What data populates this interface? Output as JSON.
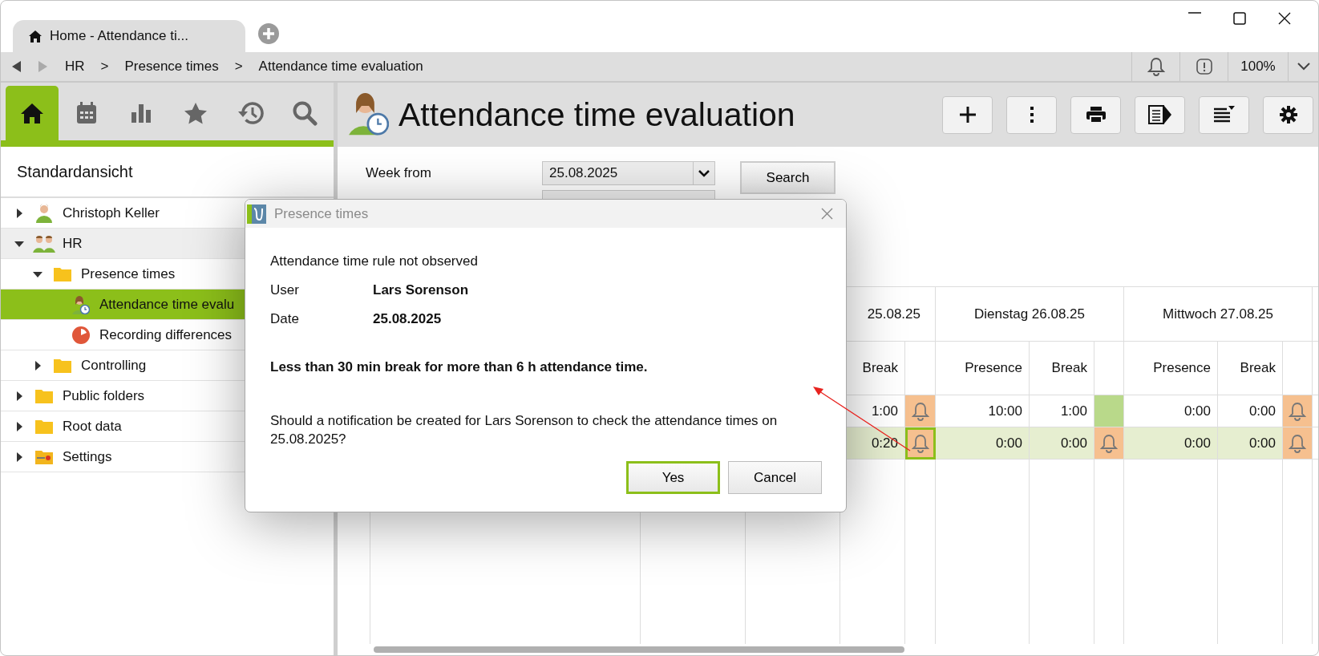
{
  "tab": {
    "label": "Home - Attendance ti..."
  },
  "breadcrumb": {
    "separator": ">",
    "items": [
      "HR",
      "Presence times",
      "Attendance time evaluation"
    ]
  },
  "status": {
    "zoom": "100%"
  },
  "sidebar": {
    "tabs": [
      {
        "kind": "home",
        "selected": true
      },
      {
        "kind": "calendar",
        "selected": false
      },
      {
        "kind": "chart",
        "selected": false
      },
      {
        "kind": "star",
        "selected": false
      },
      {
        "kind": "history",
        "selected": false
      },
      {
        "kind": "search",
        "selected": false
      }
    ],
    "view_title": "Standardansicht",
    "tree": [
      {
        "label": "Christoph Keller",
        "kind": "person",
        "expanded": false,
        "selected": false,
        "hovered": false
      },
      {
        "label": "HR",
        "kind": "group",
        "expanded": true,
        "selected": false,
        "hovered": true,
        "children": [
          {
            "label": "Presence times",
            "kind": "folder",
            "expanded": true,
            "selected": false,
            "hovered": false,
            "children": [
              {
                "label": "Attendance time evalu",
                "kind": "attendance",
                "selected": true,
                "hovered": false
              },
              {
                "label": "Recording differences",
                "kind": "pie",
                "selected": false,
                "hovered": false
              }
            ]
          },
          {
            "label": "Controlling",
            "kind": "folder",
            "expanded": false,
            "selected": false,
            "hovered": false
          }
        ]
      },
      {
        "label": "Public folders",
        "kind": "folder",
        "expanded": false,
        "selected": false,
        "hovered": false
      },
      {
        "label": "Root data",
        "kind": "folder",
        "expanded": false,
        "selected": false,
        "hovered": false
      },
      {
        "label": "Settings",
        "kind": "settings_folder",
        "expanded": false,
        "selected": false,
        "hovered": false
      }
    ]
  },
  "page": {
    "title": "Attendance time evaluation",
    "toolbar": [
      {
        "kind": "add"
      },
      {
        "kind": "more"
      },
      {
        "kind": "print"
      },
      {
        "kind": "panel"
      },
      {
        "kind": "sort"
      },
      {
        "kind": "settings"
      }
    ]
  },
  "form": {
    "week_label": "Week from",
    "week_value": "25.08.2025",
    "search_button": "Search"
  },
  "table": {
    "days": [
      {
        "header": "25.08.25",
        "break_label": "Break"
      },
      {
        "header": "Dienstag 26.08.25",
        "presence_label": "Presence",
        "break_label": "Break"
      },
      {
        "header": "Mittwoch 27.08.25",
        "presence_label": "Presence",
        "break_label": "Break"
      }
    ],
    "rows": [
      {
        "selected": false,
        "days": [
          {
            "break": "1:00",
            "alert": true,
            "selected": false
          },
          {
            "presence": "10:00",
            "break": "1:00",
            "alert": false,
            "selected": false
          },
          {
            "presence": "0:00",
            "break": "0:00",
            "alert": true,
            "selected": false
          }
        ]
      },
      {
        "selected": true,
        "days": [
          {
            "break": "0:20",
            "alert": true,
            "selected": true
          },
          {
            "presence": "0:00",
            "break": "0:00",
            "alert": true,
            "selected": false
          },
          {
            "presence": "0:00",
            "break": "0:00",
            "alert": true,
            "selected": false
          }
        ]
      }
    ]
  },
  "dialog": {
    "title": "Presence times",
    "heading": "Attendance time rule not observed",
    "fields": [
      {
        "label": "User",
        "value": "Lars Sorenson"
      },
      {
        "label": "Date",
        "value": "25.08.2025"
      }
    ],
    "message": "Less than 30 min break for more than 6 h attendance time.",
    "question": "Should a notification be created for Lars Sorenson to check the attendance times on 25.08.2025?",
    "buttons": [
      {
        "label": "Yes",
        "default": true
      },
      {
        "label": "Cancel",
        "default": false
      }
    ]
  }
}
